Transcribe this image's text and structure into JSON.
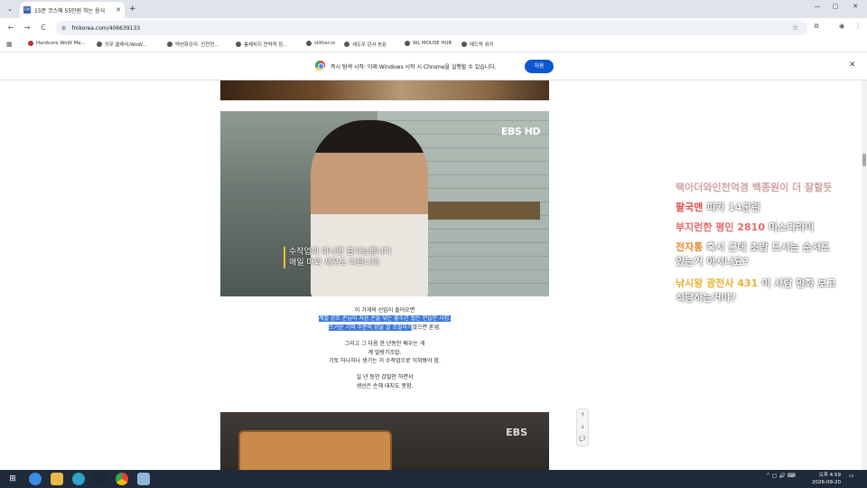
{
  "tabs": [
    {
      "title": "15분 코스에 55만원 하는 음식",
      "favicon": "FM"
    }
  ],
  "browser": {
    "url": "fmkorea.com/406639133",
    "controls": {
      "back": "←",
      "forward": "→",
      "reload": "C",
      "minimize": "—",
      "maximize": "▢",
      "close": "✕",
      "newtab": "+",
      "menu": "⌄"
    }
  },
  "bookmarks": [
    "Hardcore WoW Ma...",
    "외우 클래식/WoW...",
    "택션화강리: 인천연...",
    "룸체치지 전략적 칭...",
    "slither.io",
    "새도우 던서 농문",
    "WL MOUSE HUB",
    "메드락 위키"
  ],
  "infobar": {
    "message": "즉시 탐색 시작: 이제 Windows 시작 시 Chrome을 실행할 수 있습니다.",
    "allow_label": "허용",
    "close": "✕"
  },
  "video_frame": {
    "watermark": "EBS HD",
    "subtitle_line1": "수작업이 아니면 불가능합니다",
    "subtitle_line2": "매일 마와 새우도 다르니까"
  },
  "article": {
    "p1_line1": "이 가게의 신입이 들어오면",
    "p1_line2": "계절 강조 손님이 처음 손을 닦는 물수건 접는 연습만 시킴.",
    "p1_line3_hl": "뜨거운 기와 수분의 양을 잘 조절하기",
    "p1_line3_rest": "않으면 혼냄.",
    "p2_line1": "그리고 그 다음 한 년동안 배우는 게",
    "p2_line2": "계 말랑기조밥.",
    "p2_line3": "기토 하나하나 생기는 거 수작업으로 익혀봐야 함.",
    "p3_line1": "일 년 동안 갑밀만 하면서",
    "p3_line2": "생선은 손해 대지도 못함."
  },
  "bottom_frame": {
    "watermark": "EBS"
  },
  "side_controls": [
    "↑",
    "↓",
    "💬"
  ],
  "danmaku": [
    {
      "text": "택아더와인천억경 백종원이 더 잘할듯",
      "color": "#c48a8a"
    },
    {
      "prefix": "팔국맨",
      "text": " 피카 14군린",
      "prefix_color": "#d9534f",
      "color": "#ffffff"
    },
    {
      "prefix": "부지런한 평민 2810",
      "text": " 미스다라이",
      "prefix_color": "#e36b6b",
      "color": "#ffffff"
    },
    {
      "prefix": "전자통",
      "text": " 혹시 근데 초밥 드시는 순서도",
      "prefix_color": "#e58b2f",
      "color": "#ffffff"
    },
    {
      "text": "있는거 아시나요?",
      "color": "#ffffff"
    },
    {
      "prefix": "낚시왕 광전사 431",
      "text": " 이 사람 만화 보고",
      "prefix_color": "#e6b133",
      "color": "#ffffff"
    },
    {
      "text": "식당하는거야?",
      "color": "#ffffff"
    }
  ],
  "taskbar": {
    "time": "오후 4:59",
    "date": "2026-09-20"
  }
}
